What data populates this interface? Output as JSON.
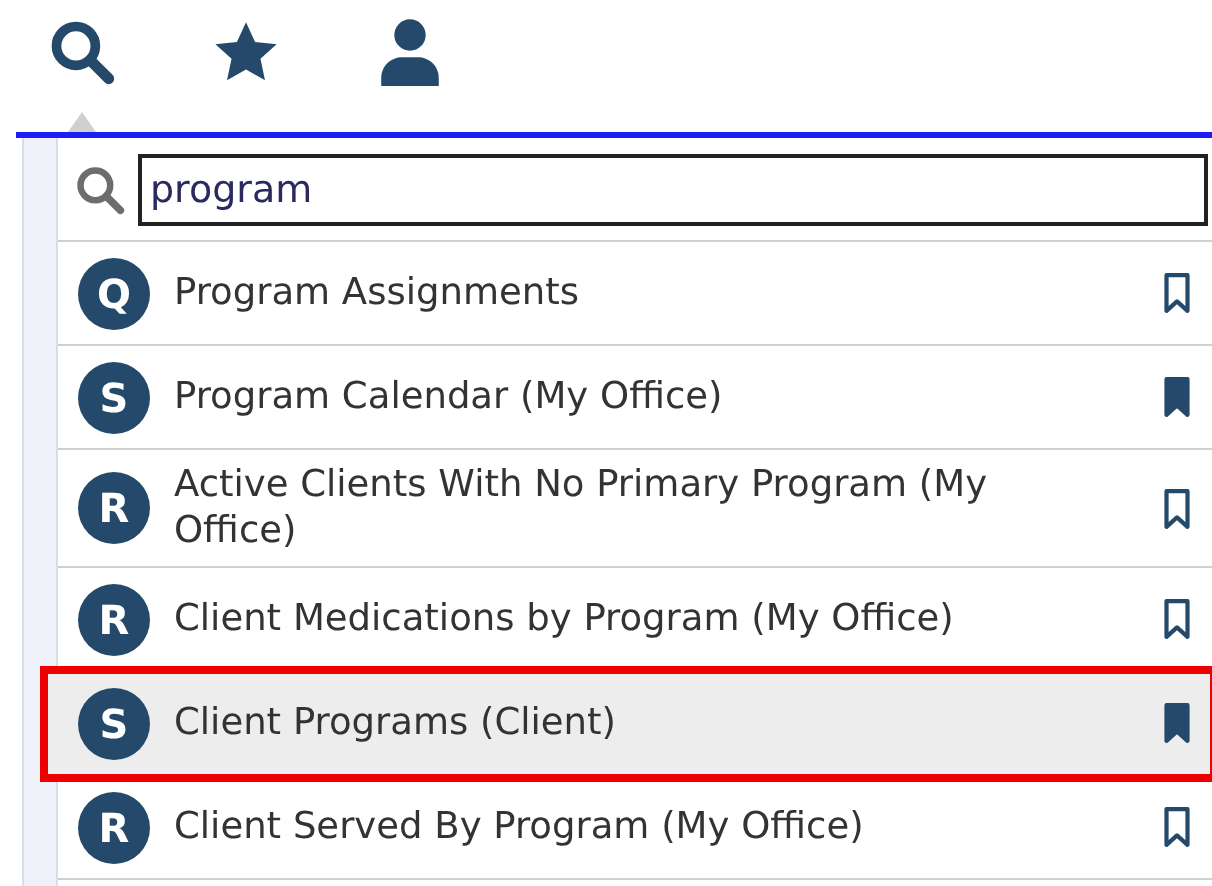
{
  "toolbar": [
    {
      "kind": "search",
      "selected": true
    },
    {
      "kind": "star",
      "selected": false
    },
    {
      "kind": "person",
      "selected": false
    }
  ],
  "search": {
    "value": "program"
  },
  "results": [
    {
      "badge": "Q",
      "label": "Program Assignments",
      "bookmarked": false,
      "selected": false,
      "highlighted": false
    },
    {
      "badge": "S",
      "label": "Program Calendar (My Office)",
      "bookmarked": true,
      "selected": false,
      "highlighted": false
    },
    {
      "badge": "R",
      "label": "Active Clients With No Primary Program (My Office)",
      "bookmarked": false,
      "selected": false,
      "highlighted": false
    },
    {
      "badge": "R",
      "label": "Client Medications by Program (My Office)",
      "bookmarked": false,
      "selected": false,
      "highlighted": false
    },
    {
      "badge": "S",
      "label": "Client Programs (Client)",
      "bookmarked": true,
      "selected": true,
      "highlighted": true
    },
    {
      "badge": "R",
      "label": "Client Served By Program (My Office)",
      "bookmarked": false,
      "selected": false,
      "highlighted": false
    }
  ]
}
